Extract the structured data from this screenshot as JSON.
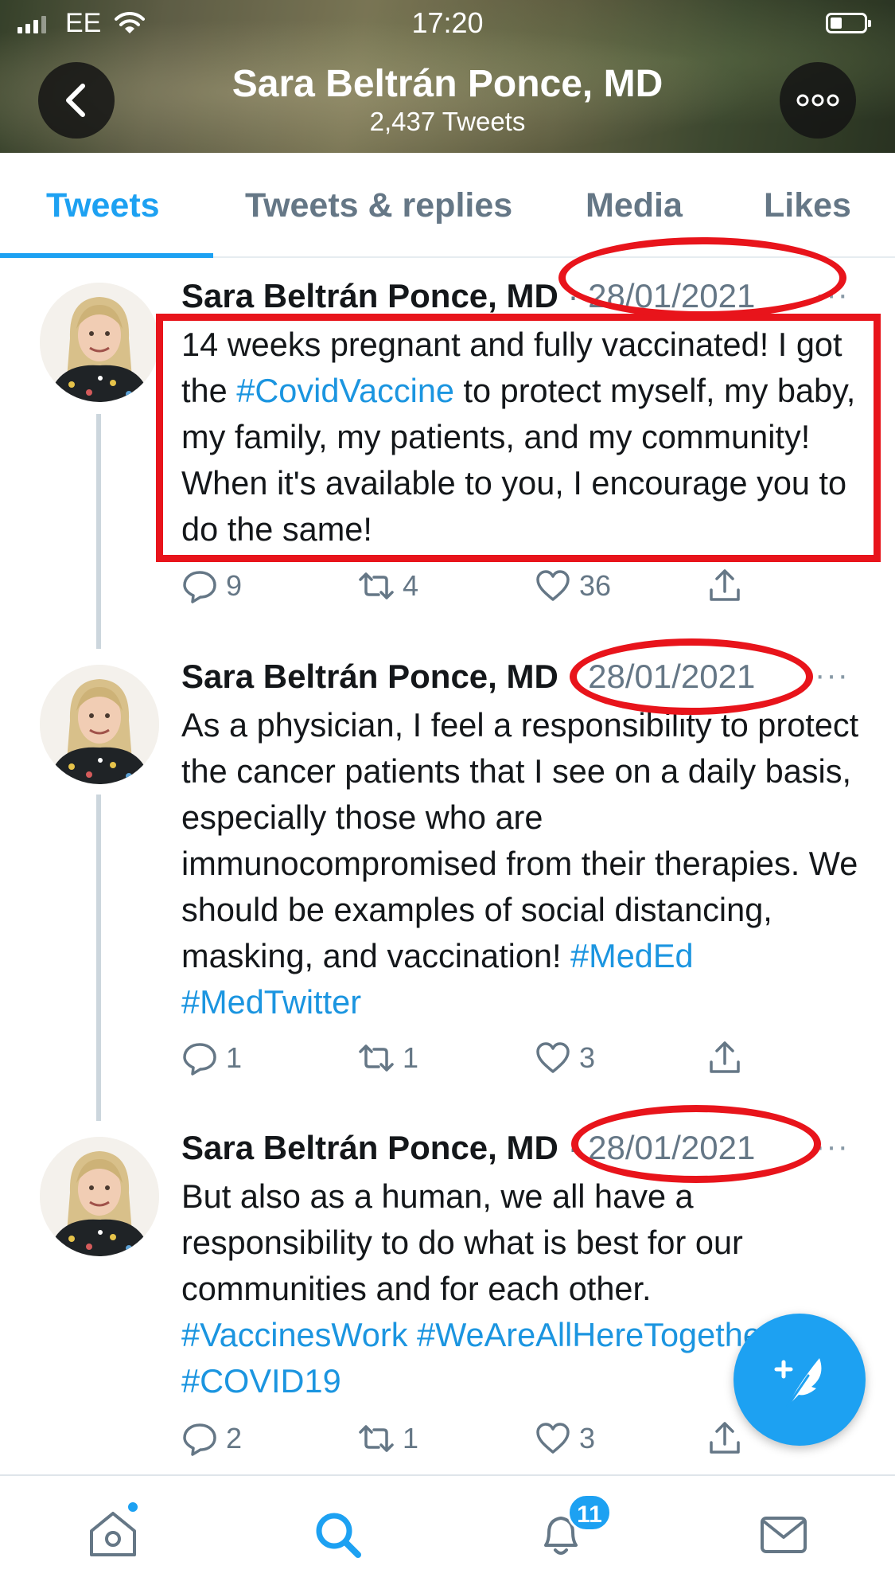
{
  "status_bar": {
    "carrier": "EE",
    "time": "17:20"
  },
  "header": {
    "name": "Sara Beltrán Ponce, MD",
    "tweet_count": "2,437 Tweets"
  },
  "tabs": [
    {
      "label": "Tweets",
      "active": true
    },
    {
      "label": "Tweets & replies",
      "active": false
    },
    {
      "label": "Media",
      "active": false
    },
    {
      "label": "Likes",
      "active": false
    }
  ],
  "tweets": [
    {
      "author": "Sara Beltrán Ponce, MD",
      "date": "· 28/01/2021",
      "text_parts": [
        "14 weeks pregnant and fully vaccinated! I got the ",
        "#CovidVaccine",
        " to protect myself, my baby, my family, my patients, and my community! When it's available to you, I encourage you to do the same!"
      ],
      "replies": "9",
      "retweets": "4",
      "likes": "36"
    },
    {
      "author": "Sara Beltrán Ponce, MD",
      "date": "· 28/01/2021",
      "text_parts": [
        "As a physician, I feel a responsibility to protect the cancer patients that I see on a daily basis, especially those who are immunocompromised from their therapies. We should be examples of social distancing, masking, and vaccination! ",
        "#MedEd #MedTwitter"
      ],
      "replies": "1",
      "retweets": "1",
      "likes": "3"
    },
    {
      "author": "Sara Beltrán Ponce, MD",
      "date": "· 28/01/2021",
      "text_parts": [
        "But also as a human, we all have a responsibility to do what is best for our communities and for each other. ",
        "#VaccinesWork #WeAreAllHereTogether #COVID19"
      ],
      "replies": "2",
      "retweets": "1",
      "likes": "3"
    }
  ],
  "notifications_badge": "11",
  "colors": {
    "accent": "#1da1f2",
    "annotation_red": "#e8141b"
  },
  "icons": [
    "back-icon",
    "more-icon",
    "reply-icon",
    "retweet-icon",
    "like-icon",
    "share-icon",
    "compose-icon",
    "home-icon",
    "search-icon",
    "notifications-icon",
    "messages-icon"
  ]
}
